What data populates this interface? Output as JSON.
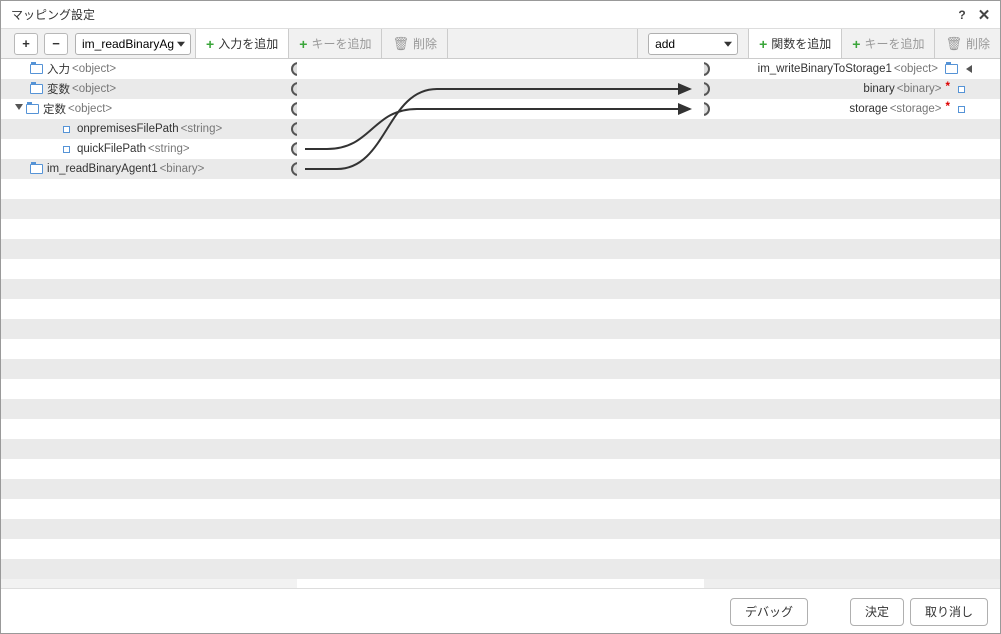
{
  "window": {
    "title": "マッピング設定"
  },
  "toolbar": {
    "left_select": "im_readBinaryAg",
    "add_input": "入力を追加",
    "add_key_left": "キーを追加",
    "delete_left": "削除",
    "right_select": "add",
    "add_function": "関数を追加",
    "add_key_right": "キーを追加",
    "delete_right": "削除"
  },
  "left_tree": [
    {
      "label": "入力",
      "type": "<object>",
      "icon": "folder",
      "indent": 0
    },
    {
      "label": "変数",
      "type": "<object>",
      "icon": "folder",
      "indent": 0
    },
    {
      "label": "定数",
      "type": "<object>",
      "icon": "folder",
      "indent": 0,
      "expanded": true
    },
    {
      "label": "onpremisesFilePath",
      "type": "<string>",
      "icon": "rect",
      "indent": 2
    },
    {
      "label": "quickFilePath",
      "type": "<string>",
      "icon": "rect",
      "indent": 2
    },
    {
      "label": "im_readBinaryAgent1",
      "type": "<binary>",
      "icon": "folder",
      "indent": 0
    }
  ],
  "right_tree": [
    {
      "label": "im_writeBinaryToStorage1",
      "type": "<object>",
      "icon": "folder",
      "required": false,
      "caret": true
    },
    {
      "label": "binary",
      "type": "<binary>",
      "icon": "rect",
      "required": true
    },
    {
      "label": "storage",
      "type": "<storage>",
      "icon": "rect",
      "required": true
    }
  ],
  "footer": {
    "debug": "デバッグ",
    "ok": "決定",
    "cancel": "取り消し"
  }
}
